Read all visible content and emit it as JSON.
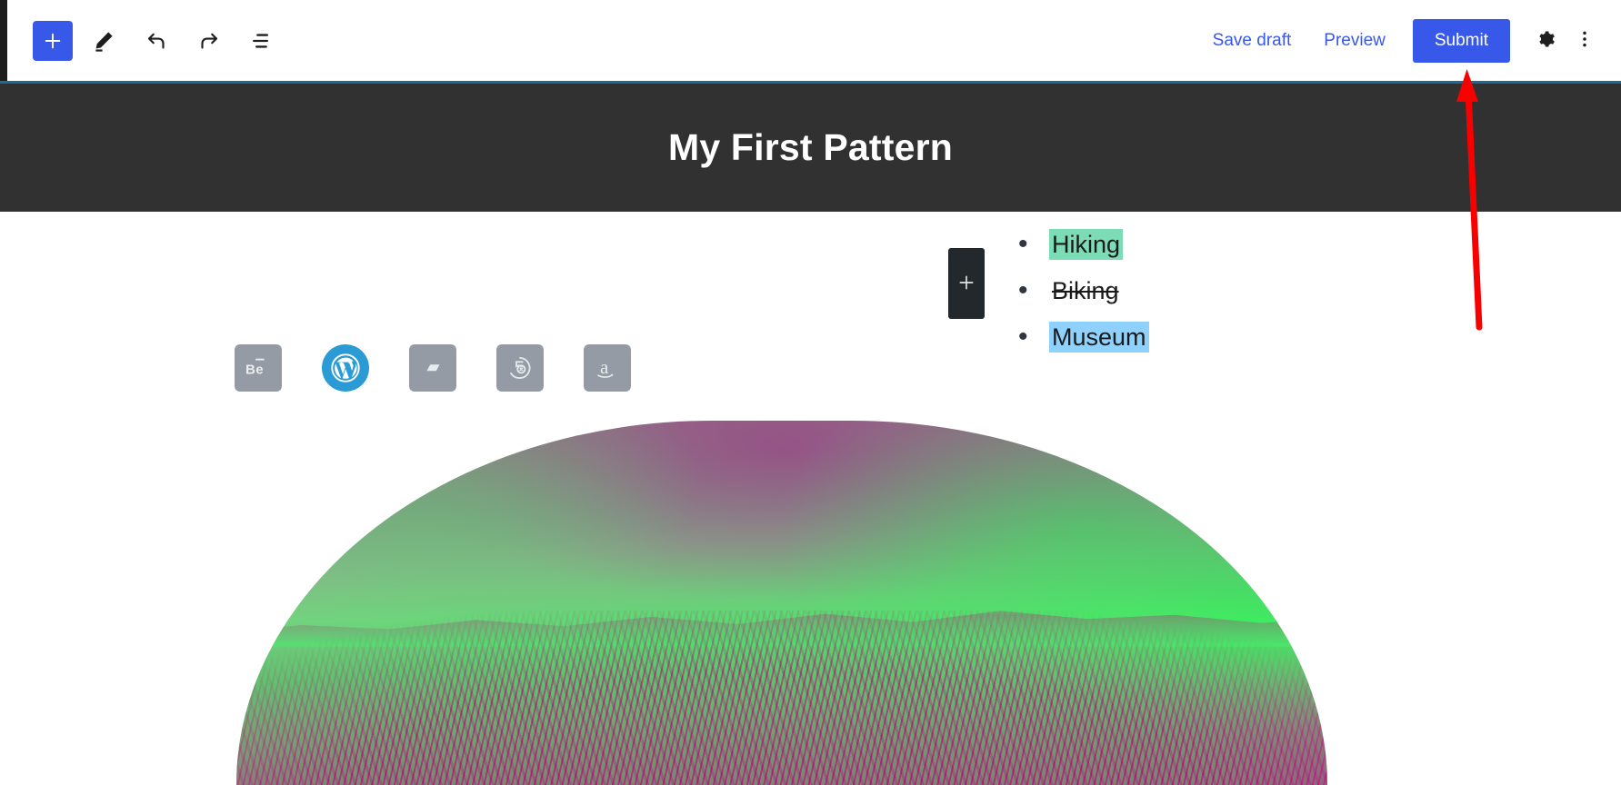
{
  "toolbar": {
    "add_block_label": "+",
    "tools": [
      {
        "name": "add-block-button",
        "icon": "plus-icon",
        "label": "Add block"
      },
      {
        "name": "tools-button",
        "icon": "pencil-icon",
        "label": "Tools"
      },
      {
        "name": "undo-button",
        "icon": "undo-icon",
        "label": "Undo"
      },
      {
        "name": "redo-button",
        "icon": "redo-icon",
        "label": "Redo"
      },
      {
        "name": "document-overview-button",
        "icon": "list-view-icon",
        "label": "Document Overview"
      }
    ],
    "save_draft_label": "Save draft",
    "preview_label": "Preview",
    "submit_label": "Submit",
    "settings_icon": "gear-icon",
    "options_icon": "more-vertical-icon",
    "accent_color": "#3858e9",
    "rule_color": "#1b6a9c"
  },
  "cover": {
    "title": "My First Pattern",
    "background_color": "#313131",
    "text_color": "#ffffff"
  },
  "content": {
    "social_icons": [
      {
        "name": "behance-icon",
        "label": "Behance",
        "glyph": "Be",
        "background": "#949ba4"
      },
      {
        "name": "wordpress-icon",
        "label": "WordPress",
        "glyph": "W",
        "background": "#2a9bd4"
      },
      {
        "name": "parallelogram-icon",
        "label": "Patreon",
        "glyph": "",
        "background": "#949ba4"
      },
      {
        "name": "fivehundredpx-icon",
        "label": "500px",
        "glyph": "5",
        "background": "#949ba4"
      },
      {
        "name": "amazon-icon",
        "label": "Amazon",
        "glyph": "a",
        "background": "#949ba4"
      }
    ],
    "block_appender_label": "+",
    "list_items": [
      {
        "text": "Hiking",
        "style": "highlight-green",
        "color": "#7bdcb5"
      },
      {
        "text": "Biking",
        "style": "strikethrough",
        "color": ""
      },
      {
        "text": "Museum",
        "style": "highlight-blue",
        "color": "#8ed1fc"
      }
    ],
    "image": {
      "name": "duotone-mountain-image",
      "alt": "Duotone green and magenta mountain landscape with arched top",
      "duotone_shadow": "#b8258c",
      "duotone_highlight": "#4ce86a"
    }
  },
  "annotation": {
    "arrow_color": "#f80000",
    "points_to": "Submit"
  }
}
